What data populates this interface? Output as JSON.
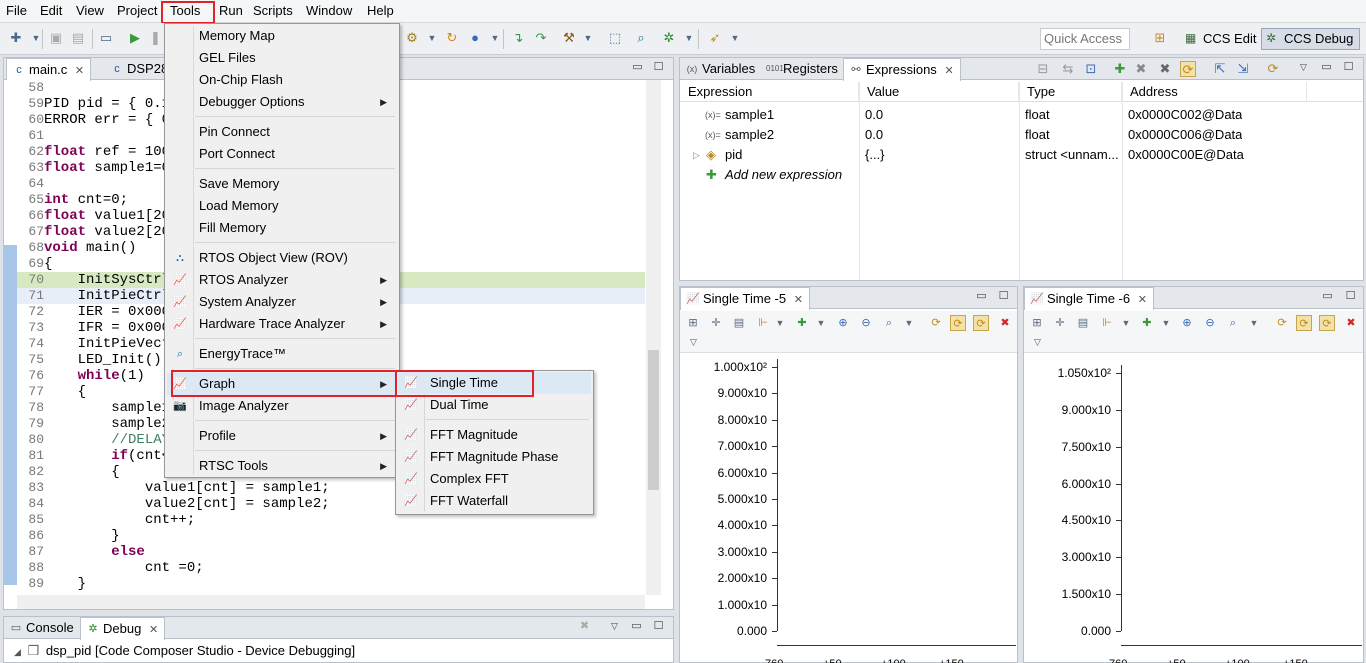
{
  "menubar": {
    "items": [
      "File",
      "Edit",
      "View",
      "Project",
      "Tools",
      "Run",
      "Scripts",
      "Window",
      "Help"
    ]
  },
  "toolbar": {
    "quick_access_placeholder": "Quick Access",
    "perspectives": [
      "CCS Edit",
      "CCS Debug"
    ],
    "active_perspective": "CCS Debug"
  },
  "editor": {
    "tabs": [
      {
        "label": "main.c",
        "icon": "c-file-icon"
      },
      {
        "label": "DSP28",
        "icon": "c-file-icon"
      }
    ],
    "lines": [
      {
        "n": "58",
        "text": ""
      },
      {
        "n": "59",
        "text": "PID pid = { 0.1"
      },
      {
        "n": "60",
        "text": "ERROR err = { 0"
      },
      {
        "n": "61",
        "text": ""
      },
      {
        "n": "62",
        "text": "float ref = 100"
      },
      {
        "n": "63",
        "text": "float sample1=0"
      },
      {
        "n": "64",
        "text": ""
      },
      {
        "n": "65",
        "text": "int cnt=0;"
      },
      {
        "n": "66",
        "text": "float value1[20"
      },
      {
        "n": "67",
        "text": "float value2[20"
      },
      {
        "n": "68",
        "text": "void main()"
      },
      {
        "n": "69",
        "text": "{"
      },
      {
        "n": "70",
        "text": "    InitSysCtrl"
      },
      {
        "n": "71",
        "text": "    InitPieCtrl"
      },
      {
        "n": "72",
        "text": "    IER = 0x000"
      },
      {
        "n": "73",
        "text": "    IFR = 0x000"
      },
      {
        "n": "74",
        "text": "    InitPieVect"
      },
      {
        "n": "75",
        "text": "    LED_Init();"
      },
      {
        "n": "76",
        "text": "    while(1)"
      },
      {
        "n": "77",
        "text": "    {"
      },
      {
        "n": "78",
        "text": "        sample1"
      },
      {
        "n": "79",
        "text": "        sample2"
      },
      {
        "n": "80",
        "text": "        //DELAY"
      },
      {
        "n": "81",
        "text": "        if(cnt<"
      },
      {
        "n": "82",
        "text": "        {"
      },
      {
        "n": "83",
        "text": "            value1[cnt] = sample1;"
      },
      {
        "n": "84",
        "text": "            value2[cnt] = sample2;"
      },
      {
        "n": "85",
        "text": "            cnt++;"
      },
      {
        "n": "86",
        "text": "        }"
      },
      {
        "n": "87",
        "text": "        else"
      },
      {
        "n": "88",
        "text": "            cnt =0;"
      },
      {
        "n": "89",
        "text": "    }"
      }
    ]
  },
  "expressions": {
    "tabs": [
      {
        "label": "Variables",
        "icon": "variables-icon"
      },
      {
        "label": "Registers",
        "icon": "registers-icon"
      },
      {
        "label": "Expressions",
        "icon": "expressions-icon"
      }
    ],
    "columns": [
      "Expression",
      "Value",
      "Type",
      "Address"
    ],
    "rows": [
      {
        "expression": "sample1",
        "value": "0.0",
        "type": "float",
        "address": "0x0000C002@Data"
      },
      {
        "expression": "sample2",
        "value": "0.0",
        "type": "float",
        "address": "0x0000C006@Data"
      },
      {
        "expression": "pid",
        "value": "{...}",
        "type": "struct <unnam...",
        "address": "0x0000C00E@Data"
      }
    ],
    "add_new": "Add new expression"
  },
  "graphs": [
    {
      "title": "Single Time -5",
      "y_labels": [
        "1.000x10²",
        "9.000x10",
        "8.000x10",
        "7.000x10",
        "6.000x10",
        "5.000x10",
        "4.000x10",
        "3.000x10",
        "2.000x10",
        "1.000x10",
        "0.000"
      ],
      "x_labels": [
        "760",
        "+50",
        "+100",
        "+150"
      ]
    },
    {
      "title": "Single Time -6",
      "y_labels": [
        "1.050x10²",
        "9.000x10",
        "7.500x10",
        "6.000x10",
        "4.500x10",
        "3.000x10",
        "1.500x10",
        "0.000"
      ],
      "x_labels": [
        "760",
        "+50",
        "+100",
        "+150"
      ]
    }
  ],
  "console": {
    "tabs": [
      {
        "label": "Console",
        "icon": "console-icon"
      },
      {
        "label": "Debug",
        "icon": "debug-icon"
      }
    ],
    "tree_item": "dsp_pid [Code Composer Studio - Device Debugging]"
  },
  "tools_menu": {
    "items": [
      {
        "label": "Memory Map",
        "submenu": false
      },
      {
        "label": "GEL Files",
        "submenu": false
      },
      {
        "label": "On-Chip Flash",
        "submenu": false
      },
      {
        "label": "Debugger Options",
        "submenu": true
      },
      {
        "label": "Pin Connect",
        "submenu": false
      },
      {
        "label": "Port Connect",
        "submenu": false
      },
      {
        "label": "Save Memory",
        "submenu": false
      },
      {
        "label": "Load Memory",
        "submenu": false
      },
      {
        "label": "Fill Memory",
        "submenu": false
      },
      {
        "label": "RTOS Object View (ROV)",
        "submenu": false
      },
      {
        "label": "RTOS Analyzer",
        "submenu": true
      },
      {
        "label": "System Analyzer",
        "submenu": true
      },
      {
        "label": "Hardware Trace Analyzer",
        "submenu": true
      },
      {
        "label": "EnergyTrace™",
        "submenu": false
      },
      {
        "label": "Graph",
        "submenu": true
      },
      {
        "label": "Image Analyzer",
        "submenu": false
      },
      {
        "label": "Profile",
        "submenu": true
      },
      {
        "label": "RTSC Tools",
        "submenu": true
      }
    ]
  },
  "graph_submenu": {
    "items": [
      "Single Time",
      "Dual Time",
      "FFT Magnitude",
      "FFT Magnitude Phase",
      "Complex FFT",
      "FFT Waterfall"
    ]
  },
  "colors": {
    "highlight_red": "#e0232b",
    "keyword": "#7f0055",
    "comment": "#3f7f5f"
  }
}
